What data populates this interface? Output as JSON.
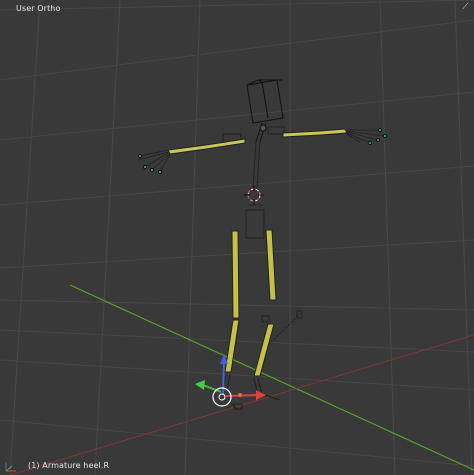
{
  "viewport": {
    "view_label": "User Ortho",
    "status_label": "(1) Armature heel.R",
    "corner_icon": "split-corner-icon",
    "colors": {
      "background": "#393939",
      "grid": "#454545",
      "x_axis": "#8a3a3a",
      "y_axis": "#5a9a2a",
      "bone_wire": "#000000",
      "bone_fill": "#c8c840",
      "cursor": "#d04040",
      "gizmo_x": "#e04040",
      "gizmo_y": "#40d040",
      "gizmo_z": "#4050e0"
    }
  }
}
